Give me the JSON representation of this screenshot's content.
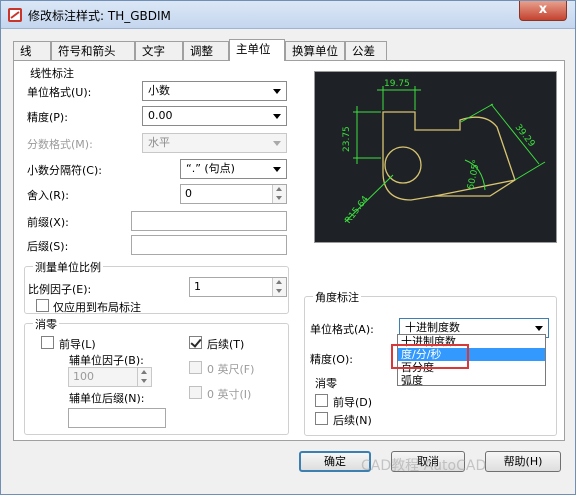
{
  "window": {
    "title": "修改标注样式: TH_GBDIM",
    "close_label": "x"
  },
  "tabs": [
    "线",
    "符号和箭头",
    "文字",
    "调整",
    "主单位",
    "换算单位",
    "公差"
  ],
  "active_tab": "主单位",
  "linear": {
    "heading": "线性标注",
    "unit_format_label": "单位格式(U):",
    "unit_format_value": "小数",
    "precision_label": "精度(P):",
    "precision_value": "0.00",
    "fraction_format_label": "分数格式(M):",
    "fraction_format_value": "水平",
    "decimal_separator_label": "小数分隔符(C):",
    "decimal_separator_value": "“.”  (句点)",
    "round_off_label": "舍入(R):",
    "round_off_value": "0",
    "prefix_label": "前缀(X):",
    "prefix_value": "",
    "suffix_label": "后缀(S):",
    "suffix_value": ""
  },
  "measurement_scale": {
    "heading": "测量单位比例",
    "scale_factor_label": "比例因子(E):",
    "scale_factor_value": "1",
    "layout_only_label": "仅应用到布局标注"
  },
  "zero_suppression": {
    "heading": "消零",
    "leading_label": "前导(L)",
    "trailing_label": "后续(T)",
    "sub_unit_factor_label": "辅单位因子(B):",
    "sub_unit_factor_value": "100",
    "sub_unit_suffix_label": "辅单位后缀(N):",
    "zero_feet_label": "0 英尺(F)",
    "zero_inches_label": "0 英寸(I)"
  },
  "preview": {
    "dims": [
      "19.75",
      "23.75",
      "39.29",
      "60.05°",
      "R15.64"
    ],
    "line_color": "#d8c470",
    "dim_color": "#3de03d"
  },
  "angular": {
    "heading": "角度标注",
    "unit_format_label": "单位格式(A):",
    "unit_format_value": "十进制度数",
    "precision_label": "精度(O):",
    "dropdown_options": [
      "十进制度数",
      "度/分/秒",
      "百分度",
      "弧度"
    ],
    "highlighted_option": "度/分/秒",
    "zero_heading": "消零",
    "leading_label": "前导(D)",
    "trailing_label": "后续(N)"
  },
  "buttons": {
    "ok": "确定",
    "cancel": "取消",
    "help": "帮助(H)"
  },
  "watermark": "CAD教程 AutoCAD"
}
